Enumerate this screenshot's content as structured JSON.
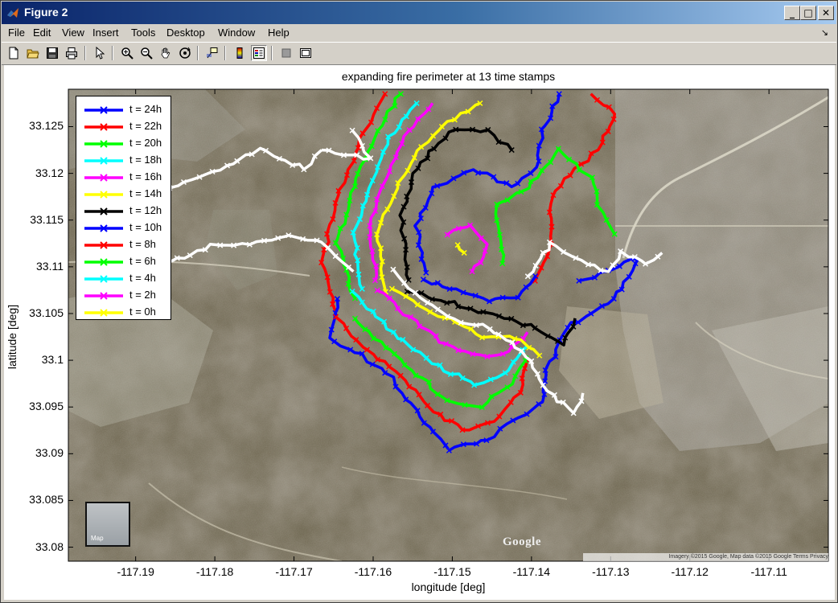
{
  "window": {
    "title": "Figure 2",
    "buttons": {
      "minimize": "_",
      "maximize": "□",
      "close": "✕"
    }
  },
  "menu": [
    "File",
    "Edit",
    "View",
    "Insert",
    "Tools",
    "Desktop",
    "Window",
    "Help"
  ],
  "menu_overflow": "↘",
  "toolbar": [
    "new-figure-icon",
    "open-file-icon",
    "save-icon",
    "print-icon",
    "edit-plot-arrow-icon",
    "zoom-in-icon",
    "zoom-out-icon",
    "pan-hand-icon",
    "rotate-3d-icon",
    "data-cursor-icon",
    "colorbar-icon",
    "legend-icon",
    "hide-plot-tools-icon",
    "show-plot-tools-icon"
  ],
  "map": {
    "google_logo": "Google",
    "attribution": "Imagery ©2015 Google, Map data ©2015 Google    Terms    Privacy",
    "thumbnail_label": "Map"
  },
  "chart_data": {
    "type": "line",
    "title": "expanding fire perimeter at 13 time stamps",
    "xlabel": "longitude [deg]",
    "ylabel": "latitude [deg]",
    "xlim": [
      -117.1985,
      -117.1025
    ],
    "ylim": [
      33.0785,
      33.129
    ],
    "xticks": [
      -117.19,
      -117.18,
      -117.17,
      -117.16,
      -117.15,
      -117.14,
      -117.13,
      -117.12,
      -117.11
    ],
    "xtick_labels": [
      "-117.19",
      "-117.18",
      "-117.17",
      "-117.16",
      "-117.15",
      "-117.14",
      "-117.13",
      "-117.12",
      "-117.11"
    ],
    "yticks": [
      33.08,
      33.085,
      33.09,
      33.095,
      33.1,
      33.105,
      33.11,
      33.115,
      33.12,
      33.125
    ],
    "ytick_labels": [
      "33.08",
      "33.085",
      "33.09",
      "33.095",
      "33.1",
      "33.105",
      "33.11",
      "33.115",
      "33.12",
      "33.125"
    ],
    "background": "satellite map",
    "legend_position": "top-left",
    "marker": "x",
    "series": [
      {
        "name": "t = 24h",
        "color": "#0000ff"
      },
      {
        "name": "t = 22h",
        "color": "#ff0000"
      },
      {
        "name": "t = 20h",
        "color": "#00ff00"
      },
      {
        "name": "t = 18h",
        "color": "#00ffff"
      },
      {
        "name": "t = 16h",
        "color": "#ff00ff"
      },
      {
        "name": "t = 14h",
        "color": "#ffff00"
      },
      {
        "name": "t = 12h",
        "color": "#000000"
      },
      {
        "name": "t = 10h",
        "color": "#0000ff"
      },
      {
        "name": "t = 8h",
        "color": "#ff0000"
      },
      {
        "name": "t = 6h",
        "color": "#00ff00"
      },
      {
        "name": "t = 4h",
        "color": "#00ffff"
      },
      {
        "name": "t = 2h",
        "color": "#ff00ff"
      },
      {
        "name": "t = 0h",
        "color": "#ffff00"
      }
    ],
    "perimeter_shapes": [
      {
        "color": "#0000ff",
        "points": [
          [
            -117.1505,
            33.0905
          ],
          [
            -117.1455,
            33.0915
          ],
          [
            -117.1415,
            33.094
          ],
          [
            -117.1385,
            33.0955
          ],
          [
            -117.138,
            33.099
          ],
          [
            -117.1355,
            33.1035
          ],
          [
            -117.1295,
            33.1065
          ],
          [
            -117.1265,
            33.111
          ],
          [
            -117.1305,
            33.1095
          ],
          [
            -117.134,
            33.1085
          ]
        ],
        "as_arc": true
      },
      {
        "color": "#0000ff",
        "points": [
          [
            -117.1645,
            33.1065
          ],
          [
            -117.1655,
            33.1025
          ],
          [
            -117.1615,
            33.1005
          ],
          [
            -117.1575,
            33.098
          ],
          [
            -117.154,
            33.094
          ],
          [
            -117.1505,
            33.0905
          ]
        ]
      },
      {
        "color": "#ff0000",
        "points": [
          [
            -117.1645,
            33.1045
          ],
          [
            -117.1615,
            33.1015
          ],
          [
            -117.1565,
            33.0985
          ],
          [
            -117.1525,
            33.0945
          ],
          [
            -117.1485,
            33.0925
          ],
          [
            -117.1445,
            33.0935
          ],
          [
            -117.1415,
            33.0965
          ],
          [
            -117.1405,
            33.1
          ]
        ]
      },
      {
        "color": "#00ff00",
        "points": [
          [
            -117.1625,
            33.1045
          ],
          [
            -117.1585,
            33.1015
          ],
          [
            -117.1545,
            33.0985
          ],
          [
            -117.1505,
            33.0955
          ],
          [
            -117.1465,
            33.095
          ],
          [
            -117.1425,
            33.0975
          ],
          [
            -117.1405,
            33.1005
          ]
        ]
      },
      {
        "color": "#00ffff",
        "points": [
          [
            -117.1625,
            33.1075
          ],
          [
            -117.1595,
            33.1045
          ],
          [
            -117.1555,
            33.1015
          ],
          [
            -117.151,
            33.099
          ],
          [
            -117.147,
            33.0975
          ],
          [
            -117.1435,
            33.0985
          ],
          [
            -117.1405,
            33.1015
          ]
        ]
      },
      {
        "color": "#ff00ff",
        "points": [
          [
            -117.1595,
            33.1075
          ],
          [
            -117.1555,
            33.1045
          ],
          [
            -117.1515,
            33.102
          ],
          [
            -117.1475,
            33.1005
          ],
          [
            -117.1435,
            33.1005
          ],
          [
            -117.1405,
            33.103
          ]
        ]
      },
      {
        "color": "#ffff00",
        "points": [
          [
            -117.1575,
            33.1075
          ],
          [
            -117.1535,
            33.1055
          ],
          [
            -117.1495,
            33.104
          ],
          [
            -117.146,
            33.1025
          ],
          [
            -117.142,
            33.1025
          ],
          [
            -117.139,
            33.1005
          ]
        ]
      },
      {
        "color": "#000000",
        "points": [
          [
            -117.1555,
            33.1075
          ],
          [
            -117.1515,
            33.1065
          ],
          [
            -117.1475,
            33.1055
          ],
          [
            -117.1435,
            33.1045
          ],
          [
            -117.1395,
            33.1035
          ],
          [
            -117.136,
            33.1015
          ],
          [
            -117.1345,
            33.1045
          ]
        ]
      },
      {
        "color": "#0000ff",
        "points": [
          [
            -117.1535,
            33.1085
          ],
          [
            -117.1495,
            33.1075
          ],
          [
            -117.1455,
            33.1065
          ],
          [
            -117.1415,
            33.1065
          ],
          [
            -117.1395,
            33.109
          ]
        ]
      },
      {
        "color": "#ffffff",
        "points": [
          [
            -117.1905,
            33.1105
          ],
          [
            -117.1895,
            33.1145
          ],
          [
            -117.1855,
            33.1185
          ],
          [
            -117.1795,
            33.1205
          ],
          [
            -117.1745,
            33.1225
          ],
          [
            -117.1685,
            33.1205
          ],
          [
            -117.1665,
            33.1225
          ]
        ],
        "as_arc": true
      },
      {
        "color": "#ffffff",
        "points": [
          [
            -117.1905,
            33.1105
          ],
          [
            -117.1855,
            33.1105
          ],
          [
            -117.1795,
            33.1125
          ],
          [
            -117.1745,
            33.1125
          ],
          [
            -117.1705,
            33.1135
          ],
          [
            -117.1665,
            33.1125
          ],
          [
            -117.1625,
            33.1095
          ]
        ]
      },
      {
        "color": "#ffffff",
        "points": [
          [
            -117.1575,
            33.1095
          ],
          [
            -117.1555,
            33.1075
          ],
          [
            -117.1505,
            33.1045
          ],
          [
            -117.1455,
            33.1035
          ],
          [
            -117.1405,
            33.1005
          ],
          [
            -117.138,
            33.0965
          ],
          [
            -117.1345,
            33.0945
          ],
          [
            -117.1335,
            33.0965
          ]
        ]
      },
      {
        "color": "#ffffff",
        "points": [
          [
            -117.1405,
            33.109
          ],
          [
            -117.1375,
            33.1125
          ],
          [
            -117.1335,
            33.1105
          ],
          [
            -117.1305,
            33.1095
          ],
          [
            -117.1285,
            33.1115
          ],
          [
            -117.1255,
            33.1105
          ],
          [
            -117.1235,
            33.1115
          ]
        ]
      }
    ],
    "inner_shapes": [
      {
        "color": "#ff00ff",
        "points": [
          [
            -117.1505,
            33.1135
          ],
          [
            -117.1475,
            33.1145
          ],
          [
            -117.1455,
            33.1125
          ],
          [
            -117.1465,
            33.1105
          ],
          [
            -117.1475,
            33.1095
          ]
        ]
      },
      {
        "color": "#ffff00",
        "points": [
          [
            -117.1495,
            33.1125
          ],
          [
            -117.1485,
            33.1115
          ]
        ]
      }
    ],
    "upper_shapes": [
      {
        "color": "#ffff00",
        "points": [
          [
            -117.1585,
            33.1075
          ],
          [
            -117.1595,
            33.1135
          ],
          [
            -117.1575,
            33.1175
          ],
          [
            -117.1545,
            33.1225
          ],
          [
            -117.1505,
            33.1255
          ],
          [
            -117.1465,
            33.1275
          ]
        ]
      },
      {
        "color": "#00ffff",
        "points": [
          [
            -117.1615,
            33.1075
          ],
          [
            -117.1625,
            33.1135
          ],
          [
            -117.1605,
            33.1185
          ],
          [
            -117.1575,
            33.1245
          ],
          [
            -117.1545,
            33.1275
          ]
        ]
      },
      {
        "color": "#ff00ff",
        "points": [
          [
            -117.1595,
            33.1085
          ],
          [
            -117.1605,
            33.1145
          ],
          [
            -117.1585,
            33.1195
          ],
          [
            -117.1555,
            33.1245
          ],
          [
            -117.1525,
            33.1275
          ]
        ]
      },
      {
        "color": "#00ff00",
        "points": [
          [
            -117.1625,
            33.1065
          ],
          [
            -117.1645,
            33.1125
          ],
          [
            -117.1625,
            33.1185
          ],
          [
            -117.1595,
            33.1245
          ],
          [
            -117.1565,
            33.1285
          ]
        ]
      },
      {
        "color": "#ff0000",
        "points": [
          [
            -117.1645,
            33.1045
          ],
          [
            -117.1665,
            33.1105
          ],
          [
            -117.1645,
            33.1175
          ],
          [
            -117.1615,
            33.1235
          ],
          [
            -117.1585,
            33.1285
          ]
        ]
      },
      {
        "color": "#000000",
        "points": [
          [
            -117.1555,
            33.1085
          ],
          [
            -117.1565,
            33.1155
          ],
          [
            -117.1545,
            33.1205
          ],
          [
            -117.1505,
            33.1245
          ],
          [
            -117.1455,
            33.1245
          ],
          [
            -117.1425,
            33.1225
          ]
        ]
      },
      {
        "color": "#0000ff",
        "points": [
          [
            -117.1535,
            33.1095
          ],
          [
            -117.1545,
            33.1145
          ],
          [
            -117.1525,
            33.1185
          ],
          [
            -117.1475,
            33.1205
          ],
          [
            -117.1425,
            33.1185
          ],
          [
            -117.1395,
            33.1205
          ],
          [
            -117.1385,
            33.1245
          ],
          [
            -117.1365,
            33.1285
          ]
        ]
      },
      {
        "color": "#ff0000",
        "points": [
          [
            -117.1395,
            33.1085
          ],
          [
            -117.1375,
            33.1125
          ],
          [
            -117.1375,
            33.1175
          ],
          [
            -117.1345,
            33.1205
          ],
          [
            -117.1315,
            33.1225
          ],
          [
            -117.1295,
            33.1265
          ],
          [
            -117.1325,
            33.1285
          ]
        ]
      },
      {
        "color": "#00ff00",
        "points": [
          [
            -117.1435,
            33.1105
          ],
          [
            -117.1445,
            33.1165
          ],
          [
            -117.1405,
            33.1185
          ],
          [
            -117.1365,
            33.1225
          ],
          [
            -117.1325,
            33.1195
          ],
          [
            -117.1315,
            33.1165
          ],
          [
            -117.1295,
            33.1135
          ]
        ]
      },
      {
        "color": "#ffffff",
        "points": [
          [
            -117.1625,
            33.1245
          ],
          [
            -117.1605,
            33.1215
          ],
          [
            -117.1665,
            33.1225
          ]
        ]
      }
    ]
  }
}
